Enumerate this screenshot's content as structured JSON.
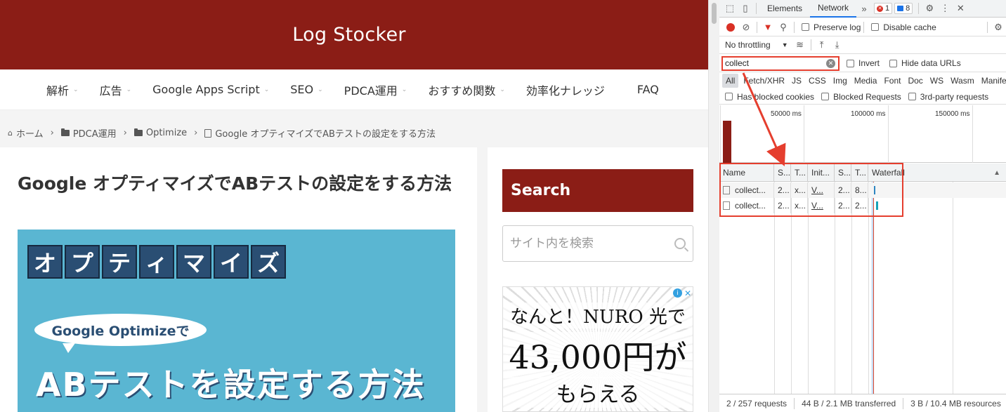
{
  "site": {
    "title": "Log Stocker",
    "nav": [
      {
        "label": "解析",
        "has_menu": true
      },
      {
        "label": "広告",
        "has_menu": true
      },
      {
        "label": "Google Apps Script",
        "has_menu": true
      },
      {
        "label": "SEO",
        "has_menu": true
      },
      {
        "label": "PDCA運用",
        "has_menu": true
      },
      {
        "label": "おすすめ関数",
        "has_menu": true
      },
      {
        "label": "効率化ナレッジ",
        "has_menu": false
      },
      {
        "label": "FAQ",
        "has_menu": false
      }
    ],
    "breadcrumb": {
      "home": "ホーム",
      "cat1": "PDCA運用",
      "cat2": "Optimize",
      "current": "Google オプティマイズでABテストの設定をする方法"
    },
    "article": {
      "title": "Google オプティマイズでABテストの設定をする方法",
      "hero": {
        "tiles": [
          "オ",
          "プ",
          "テ",
          "ィ",
          "マ",
          "イ",
          "ズ"
        ],
        "bubble": "Google Optimizeで",
        "main": "ABテストを設定する方法"
      }
    },
    "sidebar": {
      "search_title": "Search",
      "search_placeholder": "サイト内を検索",
      "ad": {
        "line1": "なんと！NURO 光で",
        "line2": "43,000円が",
        "line3": "もらえる"
      }
    },
    "colors": {
      "brand": "#8b1d16",
      "hero_bg": "#5ab6d2",
      "tile": "#2a4e73"
    }
  },
  "devtools": {
    "tabs": [
      "Elements",
      "Network"
    ],
    "active_tab": "Network",
    "more": "»",
    "error_count": "1",
    "message_count": "8",
    "toolbar": {
      "preserve_log": "Preserve log",
      "disable_cache": "Disable cache",
      "throttling": "No throttling"
    },
    "filter": {
      "value": "collect",
      "invert": "Invert",
      "hide_data_urls": "Hide data URLs"
    },
    "types": [
      "All",
      "Fetch/XHR",
      "JS",
      "CSS",
      "Img",
      "Media",
      "Font",
      "Doc",
      "WS",
      "Wasm",
      "Manife"
    ],
    "active_type": "All",
    "blocked": {
      "has_blocked_cookies": "Has blocked cookies",
      "blocked_requests": "Blocked Requests",
      "third_party": "3rd-party requests"
    },
    "overview_ticks": [
      "50000 ms",
      "100000 ms",
      "150000 ms"
    ],
    "columns": [
      "Name",
      "S...",
      "T...",
      "Init...",
      "S...",
      "T...",
      "Waterfall"
    ],
    "rows": [
      [
        "collect...",
        "2...",
        "x...",
        "V...",
        "2...",
        "8..."
      ],
      [
        "collect...",
        "2...",
        "x...",
        "V...",
        "2...",
        "2..."
      ]
    ],
    "status": {
      "requests": "2 / 257 requests",
      "transferred": "44 B / 2.1 MB transferred",
      "resources": "3 B / 10.4 MB resources"
    },
    "colors": {
      "accent": "#1a73e8",
      "record": "#d93025",
      "highlight": "#e53e2e"
    }
  }
}
